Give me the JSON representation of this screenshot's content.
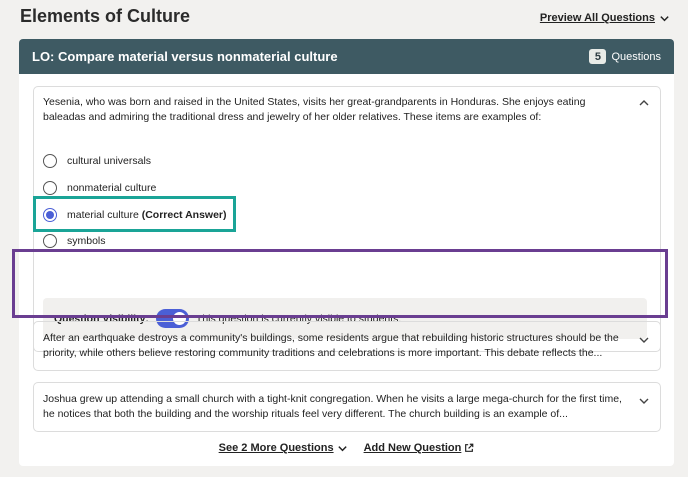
{
  "page": {
    "title": "Elements of Culture",
    "preview_all_label": "Preview All Questions"
  },
  "lo": {
    "title": "LO: Compare material versus nonmaterial culture",
    "question_count": "5",
    "question_count_label": "Questions"
  },
  "question1": {
    "text": "Yesenia, who was born and raised in the United States, visits her great-grandparents in Honduras. She enjoys eating baleadas and admiring the traditional dress and jewelry of her older relatives. These items are examples of:",
    "options": [
      {
        "label": "cultural universals",
        "selected": false
      },
      {
        "label": "nonmaterial culture",
        "selected": false
      },
      {
        "label": "material culture",
        "suffix": "(Correct Answer)",
        "selected": true
      },
      {
        "label": "symbols",
        "selected": false
      }
    ],
    "visibility_label": "Question Visibility:",
    "visibility_on": true,
    "visibility_status": "This question is currently visible to students."
  },
  "question2": {
    "text": "After an earthquake destroys a community's buildings, some residents argue that rebuilding historic structures should be the priority, while others believe restoring community traditions and celebrations is more important. This debate reflects the..."
  },
  "question3": {
    "text": "Joshua grew up attending a small church with a tight-knit congregation. When he visits a large mega-church for the first time, he notices that both the building and the worship rituals feel very different. The church building is an example of..."
  },
  "footer": {
    "see_more_label": "See 2 More Questions",
    "add_new_label": "Add New Question"
  },
  "colors": {
    "header_bg": "#3e5a63",
    "accent": "#4b5fd6",
    "highlight_green": "#1aa497",
    "highlight_purple": "#6a3e91"
  },
  "icons": [
    "chevron-down-icon",
    "chevron-up-icon",
    "external-link-icon"
  ]
}
